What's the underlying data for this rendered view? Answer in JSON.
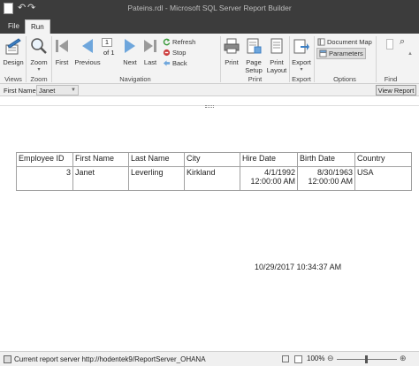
{
  "window": {
    "title": "Pateins.rdl - Microsoft SQL Server Report Builder"
  },
  "tabs": [
    {
      "label": "File",
      "active": false
    },
    {
      "label": "Run",
      "active": true
    }
  ],
  "ribbon": {
    "views": {
      "design": "Design",
      "group": "Views"
    },
    "zoom": {
      "label": "Zoom",
      "group": "Zoom"
    },
    "navigation": {
      "first": "First",
      "previous": "Previous",
      "page_value": "1",
      "of_label": "of 1",
      "next": "Next",
      "last": "Last",
      "refresh": "Refresh",
      "stop": "Stop",
      "back": "Back",
      "group": "Navigation"
    },
    "print": {
      "print": "Print",
      "page_setup_1": "Page",
      "page_setup_2": "Setup",
      "print_layout_1": "Print",
      "print_layout_2": "Layout",
      "group": "Print"
    },
    "export": {
      "label": "Export",
      "group": "Export"
    },
    "options": {
      "document_map": "Document Map",
      "parameters": "Parameters",
      "group": "Options"
    },
    "find": {
      "group": "Find"
    }
  },
  "parameters": {
    "first_name_label": "First Name",
    "first_name_value": "Janet",
    "view_report": "View Report"
  },
  "report": {
    "columns": [
      "Employee ID",
      "First Name",
      "Last Name",
      "City",
      "Hire Date",
      "Birth Date",
      "Country"
    ],
    "rows": [
      {
        "employee_id": "3",
        "first_name": "Janet",
        "last_name": "Leverling",
        "city": "Kirkland",
        "hire_date_1": "4/1/1992",
        "hire_date_2": "12:00:00 AM",
        "birth_date_1": "8/30/1963",
        "birth_date_2": "12:00:00 AM",
        "country": "USA"
      }
    ],
    "timestamp": "10/29/2017 10:34:37 AM"
  },
  "status": {
    "server_text": "Current report server http://hodentek9/ReportServer_OHANA",
    "zoom_level": "100%"
  },
  "colors": {
    "title_bar": "#3c3c3c",
    "ribbon": "#f3f3f3",
    "nav_blue": "#6ea6dc",
    "refresh_green": "#3a9a3a",
    "stop_red": "#cc3b3b"
  }
}
